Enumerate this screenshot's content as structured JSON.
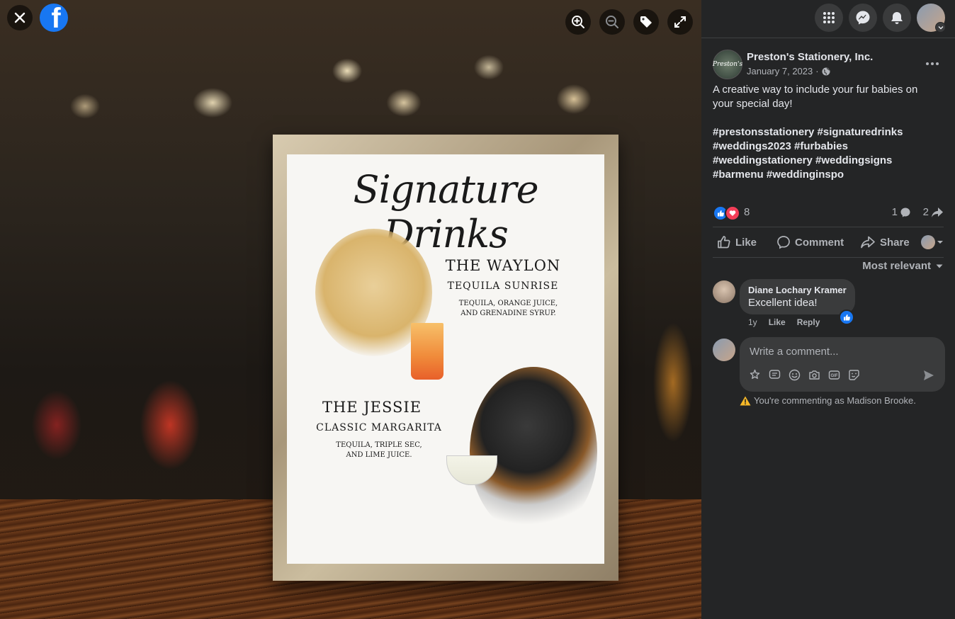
{
  "viewer": {
    "icons": {
      "close": "close-icon",
      "logo": "facebook-logo",
      "zoom_in": "zoom-in-icon",
      "zoom_out": "zoom-out-icon",
      "tag": "tag-icon",
      "fullscreen": "fullscreen-icon"
    },
    "photo": {
      "title": "Signature Drinks",
      "drink1": {
        "name": "THE WAYLON",
        "drink": "TEQUILA SUNRISE",
        "description": "TEQUILA, ORANGE JUICE, AND GRENADINE SYRUP."
      },
      "drink2": {
        "name": "THE JESSIE",
        "drink": "CLASSIC MARGARITA",
        "description": "TEQUILA, TRIPLE SEC, AND LIME JUICE."
      }
    }
  },
  "topbar": {
    "icons": [
      "menu-grid-icon",
      "messenger-icon",
      "notifications-bell-icon",
      "account-avatar"
    ]
  },
  "post": {
    "page_name": "Preston's Stationery, Inc.",
    "avatar_text": "Preston's",
    "date": "January 7, 2023",
    "audience_icon": "globe-icon",
    "text": "A creative way to include your fur babies on your special day!",
    "hashtags": "#prestonsstationery #signaturedrinks #weddings2023 #furbabies #weddingstationery #weddingsigns #barmenu #weddinginspo",
    "reaction_count": "8",
    "comment_count": "1",
    "share_count": "2"
  },
  "actions": {
    "like": "Like",
    "comment": "Comment",
    "share": "Share"
  },
  "sort": {
    "label": "Most relevant"
  },
  "comment": {
    "author": "Diane Lochary Kramer",
    "text": "Excellent idea!",
    "age": "1y",
    "like": "Like",
    "reply": "Reply"
  },
  "composer": {
    "placeholder": "Write a comment...",
    "notice": "You're commenting as Madison Brooke."
  },
  "colors": {
    "accent": "#1877f2",
    "love": "#f33e58",
    "panel_bg": "#242526",
    "bubble_bg": "#3a3b3c"
  }
}
